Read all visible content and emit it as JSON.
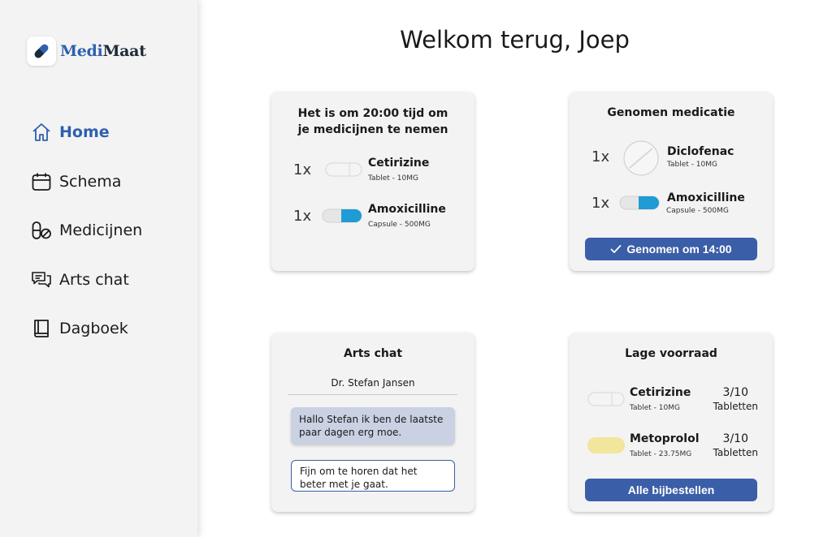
{
  "app": {
    "brand_part1": "Medi",
    "brand_part2": "Maat",
    "accent_color": "#3b5ea8"
  },
  "sidebar": {
    "items": [
      {
        "label": "Home",
        "icon": "home-icon",
        "active": true
      },
      {
        "label": "Schema",
        "icon": "calendar-icon",
        "active": false
      },
      {
        "label": "Medicijnen",
        "icon": "pills-icon",
        "active": false
      },
      {
        "label": "Arts chat",
        "icon": "chat-icon",
        "active": false
      },
      {
        "label": "Dagboek",
        "icon": "book-icon",
        "active": false
      }
    ]
  },
  "main": {
    "title": "Welkom terug, Joep"
  },
  "reminder_card": {
    "title": "Het is om 20:00 tijd om je medicijnen te nemen",
    "meds": [
      {
        "qty": "1x",
        "name": "Cetirizine",
        "detail": "Tablet - 10MG",
        "icon": "white-capsule-icon"
      },
      {
        "qty": "1x",
        "name": "Amoxicilline",
        "detail": "Capsule - 500MG",
        "icon": "blue-capsule-icon"
      }
    ]
  },
  "taken_card": {
    "title": "Genomen medicatie",
    "meds": [
      {
        "qty": "1x",
        "name": "Diclofenac",
        "detail": "Tablet - 10MG",
        "icon": "round-tablet-icon"
      },
      {
        "qty": "1x",
        "name": "Amoxicilline",
        "detail": "Capsule - 500MG",
        "icon": "blue-capsule-icon"
      }
    ],
    "button_label": "Genomen om 14:00"
  },
  "chat_card": {
    "title": "Arts chat",
    "doctor": "Dr. Stefan Jansen",
    "messages": [
      {
        "from": "patient",
        "text": "Hallo Stefan ik ben de laatste paar dagen erg moe."
      },
      {
        "from": "doctor",
        "text": "Fijn om te horen dat het beter met je gaat."
      }
    ]
  },
  "stock_card": {
    "title": "Lage voorraad",
    "meds": [
      {
        "name": "Cetirizine",
        "detail": "Tablet - 10MG",
        "stock": "3/10",
        "unit": "Tabletten",
        "icon": "white-capsule-icon"
      },
      {
        "name": "Metoprolol",
        "detail": "Tablet - 23.75MG",
        "stock": "3/10",
        "unit": "Tabletten",
        "icon": "yellow-tablet-icon"
      }
    ],
    "button_label": "Alle bijbestellen"
  }
}
